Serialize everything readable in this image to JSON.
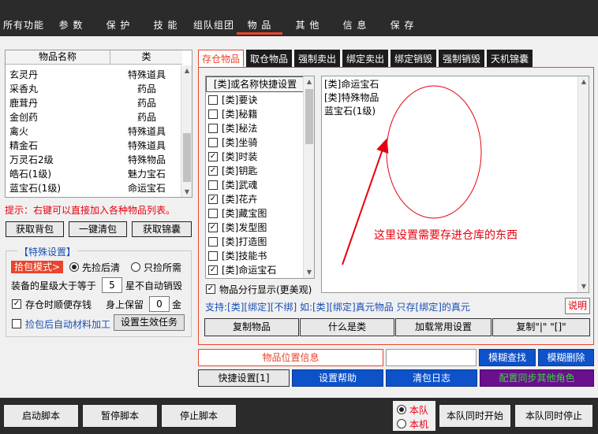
{
  "top_tabs": [
    "所有功能",
    "参 数",
    "保 护",
    "技 能",
    "组队组团",
    "物 品",
    "其 他",
    "信 息",
    "保 存"
  ],
  "active_top_tab": "物 品",
  "item_list": {
    "col_name": "物品名称",
    "col_type": "类",
    "rows": [
      {
        "name": "玄灵丹",
        "type": "特殊道具"
      },
      {
        "name": "采香丸",
        "type": "药品"
      },
      {
        "name": "鹿茸丹",
        "type": "药品"
      },
      {
        "name": "金创药",
        "type": "药品"
      },
      {
        "name": "禽火",
        "type": "特殊道具"
      },
      {
        "name": "精金石",
        "type": "特殊道具"
      },
      {
        "name": "万灵石2级",
        "type": "特殊物品"
      },
      {
        "name": "皓石(1级)",
        "type": "魅力宝石"
      },
      {
        "name": "蓝宝石(1级)",
        "type": "命运宝石"
      }
    ]
  },
  "hint": "提示：右键可以直接加入各种物品列表。",
  "left_buttons": [
    "获取背包",
    "一键清包",
    "获取锦囊"
  ],
  "special": {
    "title": "【特殊设置】",
    "mode_label": "拾包模式>",
    "radio1": "先捡后清",
    "radio2": "只捡所需",
    "star_label1": "装备的星级大于等于",
    "star_value": "5",
    "star_label2": "星不自动销毁",
    "deposit_label": "存仓时顺便存钱",
    "keep_label": "身上保留",
    "keep_value": "0",
    "keep_unit": "金",
    "auto_label": "捡包后自动材料加工",
    "apply_btn": "设置生效任务"
  },
  "right_tabs": [
    "存仓物品",
    "取仓物品",
    "强制卖出",
    "绑定卖出",
    "绑定销毁",
    "强制销毁",
    "天机锦囊"
  ],
  "active_right_tab": "存仓物品",
  "checklist": {
    "header": "[类]或名称快捷设置",
    "items": [
      {
        "label": "[类]要诀",
        "checked": false
      },
      {
        "label": "[类]秘籍",
        "checked": false
      },
      {
        "label": "[类]秘法",
        "checked": false
      },
      {
        "label": "[类]坐骑",
        "checked": false
      },
      {
        "label": "[类]时装",
        "checked": true
      },
      {
        "label": "[类]钥匙",
        "checked": true
      },
      {
        "label": "[类]武魂",
        "checked": false
      },
      {
        "label": "[类]花卉",
        "checked": true
      },
      {
        "label": "[类]藏宝图",
        "checked": false
      },
      {
        "label": "[类]发型图",
        "checked": true
      },
      {
        "label": "[类]打造图",
        "checked": false
      },
      {
        "label": "[类]技能书",
        "checked": false
      },
      {
        "label": "[类]命运宝石",
        "checked": true
      }
    ]
  },
  "text_lines": [
    "[类]命运宝石",
    "[类]特殊物品",
    "蓝宝石(1级)"
  ],
  "annotation": "这里设置需要存进仓库的东西",
  "row_display_label": "物品分行显示(更美观)",
  "support_text": "支持:[类][绑定][不绑] 如:[类][绑定]真元物品 只存[绑定]的真元",
  "explain_btn": "说明",
  "panel_buttons": [
    "复制物品",
    "什么是类",
    "加载常用设置",
    "复制\"|\" \"[]\""
  ],
  "location_label": "物品位置信息",
  "fuzzy_search": "模糊查找",
  "fuzzy_delete": "模糊删除",
  "row2_buttons": [
    "快捷设置[1]",
    "设置帮助",
    "清包日志",
    "配置同步其他角色"
  ],
  "bottom_buttons": [
    "启动脚本",
    "暂停脚本",
    "停止脚本"
  ],
  "team_radio1": "本队",
  "team_radio2": "本机",
  "team_start": "本队同时开始",
  "team_stop": "本队同时停止",
  "colors": {
    "accent": "#e8452d",
    "blue": "#0e52c9",
    "purple": "#6a0f8e",
    "green_text": "#3bd53b"
  }
}
